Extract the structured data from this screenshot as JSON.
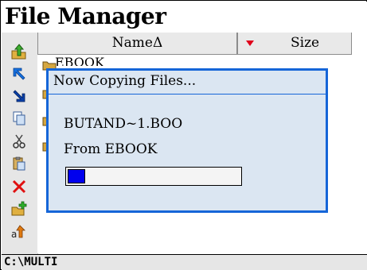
{
  "window": {
    "title": "File Manager"
  },
  "columns": {
    "name_label": "NameΔ",
    "size_label": "Size"
  },
  "list": {
    "items": [
      {
        "label": "EBOOK"
      }
    ]
  },
  "toolbar": {
    "tools": [
      {
        "icon": "up-folder-icon"
      },
      {
        "icon": "arrow-up-left-icon"
      },
      {
        "icon": "arrow-down-right-icon"
      },
      {
        "icon": "copy-icon"
      },
      {
        "icon": "cut-icon"
      },
      {
        "icon": "paste-icon"
      },
      {
        "icon": "delete-icon"
      },
      {
        "icon": "new-folder-icon"
      },
      {
        "icon": "rename-icon"
      }
    ]
  },
  "dialog": {
    "title": "Now Copying Files...",
    "file_name": "BUTAND~1.BOO",
    "from_text": "From EBOOK",
    "progress": 0.1
  },
  "status": {
    "path": "C:\\MULTI"
  },
  "colors": {
    "accent": "#1565d8",
    "progress_fill": "#0000ee",
    "sort_arrow": "#e0001a"
  }
}
